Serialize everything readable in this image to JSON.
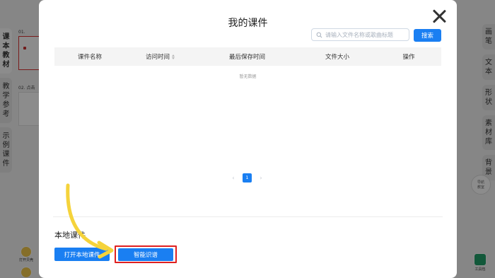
{
  "background": {
    "left_tabs": [
      "课本教材",
      "教学参考",
      "示例课件"
    ],
    "thumbnails": [
      {
        "label": "01."
      },
      {
        "label": "02. 点击"
      }
    ],
    "bottom_left": {
      "open_label": "打开贝壳",
      "home_label": "首页"
    },
    "right_tabs": [
      "画笔",
      "文本",
      "形状",
      "素材库",
      "背景"
    ],
    "nav_label": "导航\n教室",
    "toolbox_label": "工具包"
  },
  "modal": {
    "title": "我的课件",
    "search_placeholder": "请输入文件名称或歌曲标题",
    "search_button": "搜索",
    "columns": [
      "课件名称",
      "访问时间",
      "最后保存时间",
      "文件大小",
      "操作"
    ],
    "empty_text": "暂无数据",
    "pagination": {
      "current_page": "1",
      "prev_icon": "chevron-left-icon",
      "next_icon": "chevron-right-icon"
    },
    "local_section_title": "本地课件",
    "open_local_button": "打开本地课件",
    "smart_recognize_button": "智能识谱"
  },
  "colors": {
    "primary": "#1a7ff2",
    "highlight_frame": "#e02020",
    "arrow": "#f5d33b"
  }
}
